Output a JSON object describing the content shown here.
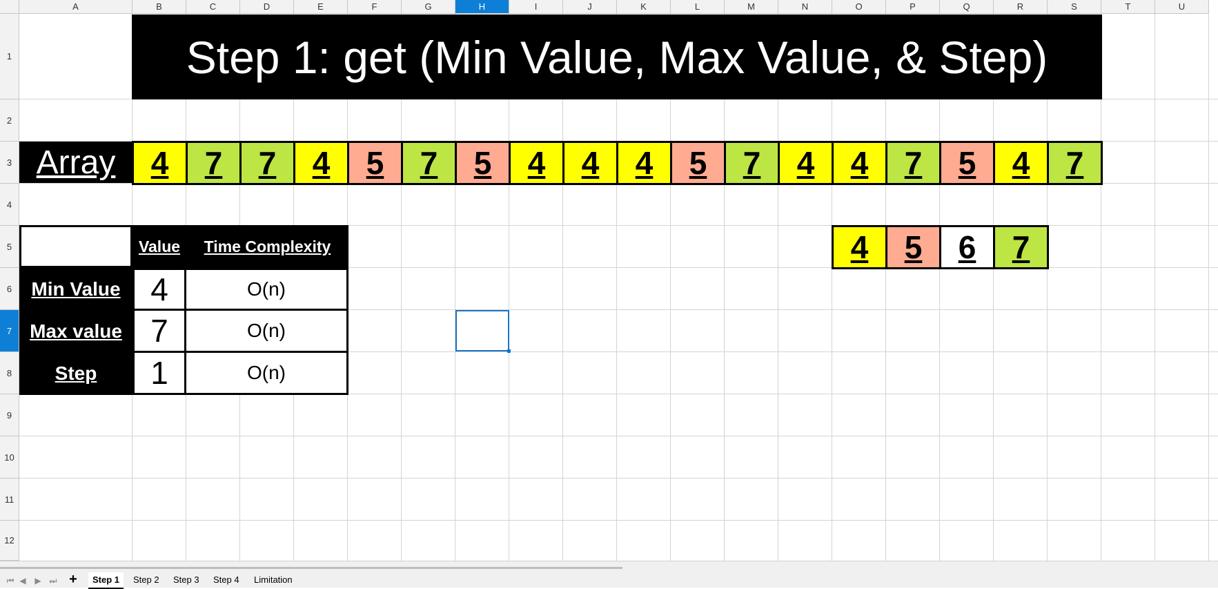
{
  "columns": [
    "A",
    "B",
    "C",
    "D",
    "E",
    "F",
    "G",
    "H",
    "I",
    "J",
    "K",
    "L",
    "M",
    "N",
    "O",
    "P",
    "Q",
    "R",
    "S",
    "T",
    "U"
  ],
  "selected_column": "H",
  "rows": [
    "1",
    "2",
    "3",
    "4",
    "5",
    "6",
    "7",
    "8",
    "9",
    "10",
    "11",
    "12"
  ],
  "selected_row": "7",
  "title": "Step 1: get (Min Value, Max Value, & Step)",
  "array_label": "Array",
  "array_values": [
    "4",
    "7",
    "7",
    "4",
    "5",
    "7",
    "5",
    "4",
    "4",
    "4",
    "5",
    "7",
    "4",
    "4",
    "7",
    "5",
    "4",
    "7"
  ],
  "range_values": [
    "4",
    "5",
    "6",
    "7"
  ],
  "colors": {
    "yellow": "#ffff00",
    "green": "#bde544",
    "salmon": "#ffab91",
    "white": "#ffffff",
    "black": "#000000",
    "selection": "#0e7fd6"
  },
  "table": {
    "header_value": "Value",
    "header_complexity": "Time Complexity",
    "rows": [
      {
        "label": "Min Value",
        "value": "4",
        "complexity": "O(n)"
      },
      {
        "label": "Max value",
        "value": "7",
        "complexity": "O(n)"
      },
      {
        "label": "Step",
        "value": "1",
        "complexity": "O(n)"
      }
    ]
  },
  "sheet_tabs": {
    "add_icon": "plus-icon",
    "nav_icons": [
      "first-sheet-icon",
      "prev-sheet-icon",
      "next-sheet-icon",
      "last-sheet-icon"
    ],
    "tabs": [
      "Step 1",
      "Step 2",
      "Step 3",
      "Step 4",
      "Limitation"
    ],
    "active_tab": "Step 1"
  }
}
